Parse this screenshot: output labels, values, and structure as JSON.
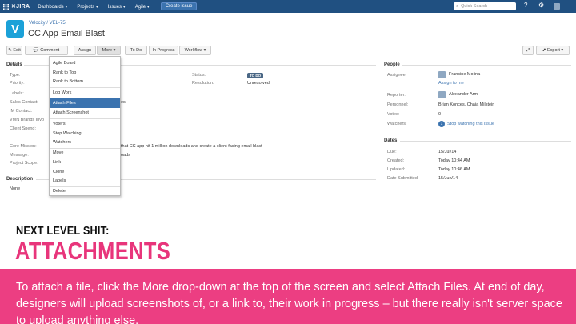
{
  "topnav": {
    "logo": "JIRA",
    "items": [
      "Dashboards ▾",
      "Projects ▾",
      "Issues ▾",
      "Agile ▾"
    ],
    "create_label": "Create issue",
    "search_placeholder": "Quick Search",
    "bg_color": "#205081"
  },
  "header": {
    "project_logo_letter": "V",
    "breadcrumb": "Velocity  /  VEL-75",
    "title": "CC App Email Blast"
  },
  "toolbar": {
    "edit": "✎ Edit",
    "comment": "💬 Comment",
    "assign": "Assign",
    "more": "More ▾",
    "todo": "To Do",
    "in_progress": "In Progress",
    "workflow": "Workflow ▾",
    "export": "⬈ Export ▾"
  },
  "details": {
    "heading": "Details",
    "labels": [
      "Type:",
      "Priority:",
      "Labels:",
      "Sales Contact:",
      "IM Contact:",
      "VMN Brands Invo",
      "Client Spend:",
      "Core Mission:",
      "Message:",
      "Project Scope:"
    ],
    "status_label": "Status:",
    "status_value": "TO DO",
    "resolution_label": "Resolution:",
    "resolution_value": "Unresolved",
    "sales_contact_tail": "es",
    "core_mission_value": "that CC app hit 1 million downloads and create a client facing email blast",
    "message_value": "oads",
    "description_heading": "Description",
    "description_value": "None"
  },
  "more_menu": {
    "items": [
      "Agile Board",
      "Rank to Top",
      "Rank to Bottom",
      "Log Work",
      "Attach Files",
      "Attach Screenshot",
      "Voters",
      "Stop Watching",
      "Watchers",
      "Move",
      "Link",
      "Clone",
      "Labels",
      "Delete"
    ],
    "highlighted": "Attach Files"
  },
  "people": {
    "heading": "People",
    "assignee_label": "Assignee:",
    "assignee_value": "Francine Molina",
    "assign_to_me": "Assign to me",
    "reporter_label": "Reporter:",
    "reporter_value": "Alexander Arm",
    "personnel_label": "Personnel:",
    "personnel_value": "Brian Konces, Chaia Milstein",
    "votes_label": "Votes:",
    "votes_value": "0",
    "watchers_label": "Watchers:",
    "watchers_count": "1",
    "watchers_link": "Stop watching this issue"
  },
  "dates": {
    "heading": "Dates",
    "rows": [
      {
        "label": "Due:",
        "value": "15/Jul/14"
      },
      {
        "label": "Created:",
        "value": "Today 10:44 AM"
      },
      {
        "label": "Updated:",
        "value": "Today 10:46 AM"
      },
      {
        "label": "Date Submitted:",
        "value": "15/Jun/14"
      }
    ]
  },
  "overlay": {
    "kicker": "NEXT LEVEL SHIT:",
    "heading": "ATTACHMENTS",
    "heading_color": "#e8357b",
    "body": "To attach a file, click the More drop-down at the top of the screen and select Attach Files. At end of day, designers will upload screenshots of, or a link to, their work in progress – but there really isn't server space to upload anything else.",
    "band_color": "#ec3e82"
  }
}
